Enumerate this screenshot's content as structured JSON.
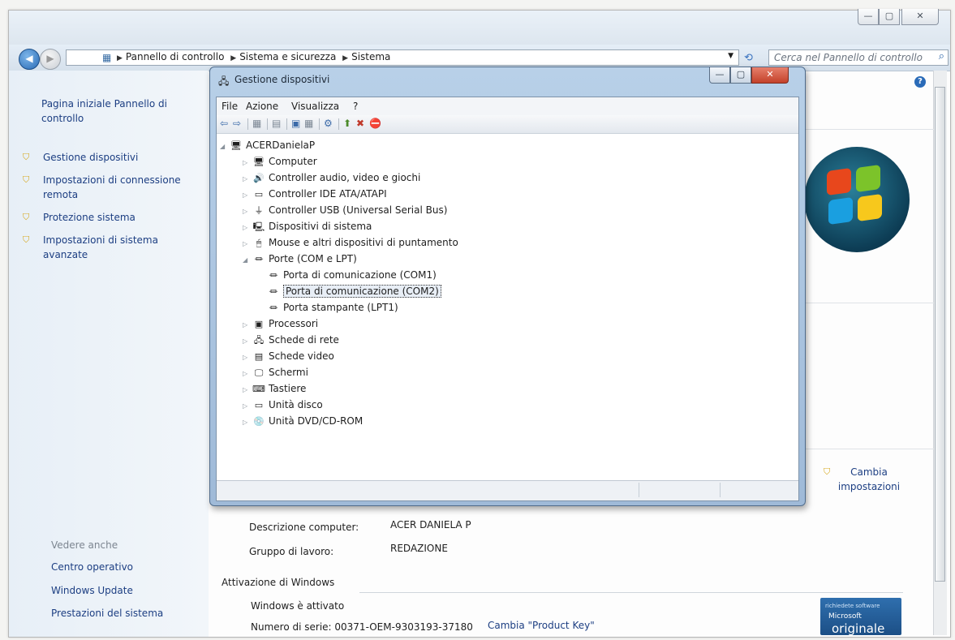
{
  "outer": {
    "caption_min": "—",
    "caption_max": "▢",
    "caption_close": "✕",
    "breadcrumb": [
      "Pannello di controllo",
      "Sistema e sicurezza",
      "Sistema"
    ],
    "breadcrumb_sep": "▶",
    "search_placeholder": "Cerca nel Pannello di controllo"
  },
  "left_pane": {
    "home_link": "Pagina iniziale Pannello di controllo",
    "tasks": [
      {
        "label": "Gestione dispositivi",
        "icon": "shield-icon"
      },
      {
        "label": "Impostazioni di connessione remota",
        "icon": "shield-icon"
      },
      {
        "label": "Protezione sistema",
        "icon": "shield-icon"
      },
      {
        "label": "Impostazioni di sistema avanzate",
        "icon": "shield-icon"
      }
    ],
    "see_also_title": "Vedere anche",
    "see_also": [
      "Centro operativo",
      "Windows Update",
      "Prestazioni del sistema"
    ]
  },
  "main": {
    "change_settings": "Cambia impostazioni",
    "computer_description_label": "Descrizione computer:",
    "computer_description_value": "ACER DANIELA P",
    "workgroup_label": "Gruppo di lavoro:",
    "workgroup_value": "REDAZIONE",
    "activation_title": "Attivazione di Windows",
    "activation_status": "Windows è attivato",
    "serial_label": "Numero di serie: 00371-OEM-9303193-37180",
    "change_product_key": "Cambia \"Product Key\"",
    "badge_small": "richiedete software",
    "badge_ms": "Microsoft",
    "badge_big": "originale"
  },
  "device_manager": {
    "title": "Gestione dispositivi",
    "menu": [
      "File",
      "Azione",
      "Visualizza",
      "?"
    ],
    "root": "ACERDanielaP",
    "categories": [
      {
        "label": "Computer",
        "icon": "computer-icon",
        "expanded": false
      },
      {
        "label": "Controller audio, video e giochi",
        "icon": "speaker-icon",
        "expanded": false
      },
      {
        "label": "Controller IDE ATA/ATAPI",
        "icon": "ide-controller-icon",
        "expanded": false
      },
      {
        "label": "Controller USB (Universal Serial Bus)",
        "icon": "usb-icon",
        "expanded": false
      },
      {
        "label": "Dispositivi di sistema",
        "icon": "system-device-icon",
        "expanded": false
      },
      {
        "label": "Mouse e altri dispositivi di puntamento",
        "icon": "mouse-icon",
        "expanded": false
      },
      {
        "label": "Porte (COM e LPT)",
        "icon": "port-icon",
        "expanded": true,
        "children": [
          "Porta di comunicazione (COM1)",
          "Porta di comunicazione (COM2)",
          "Porta stampante (LPT1)"
        ],
        "selected_child": "Porta di comunicazione (COM2)"
      },
      {
        "label": "Processori",
        "icon": "processor-icon",
        "expanded": false
      },
      {
        "label": "Schede di rete",
        "icon": "network-icon",
        "expanded": false
      },
      {
        "label": "Schede video",
        "icon": "video-card-icon",
        "expanded": false
      },
      {
        "label": "Schermi",
        "icon": "monitor-icon",
        "expanded": false
      },
      {
        "label": "Tastiere",
        "icon": "keyboard-icon",
        "expanded": false
      },
      {
        "label": "Unità disco",
        "icon": "disk-icon",
        "expanded": false
      },
      {
        "label": "Unità DVD/CD-ROM",
        "icon": "dvd-icon",
        "expanded": false
      }
    ]
  }
}
